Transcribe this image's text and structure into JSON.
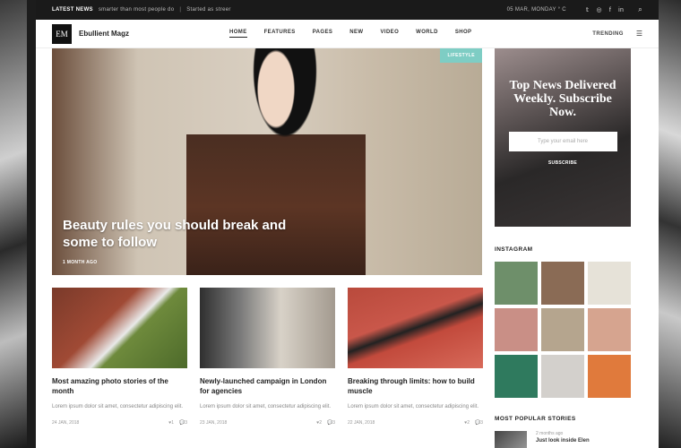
{
  "topbar": {
    "label": "LATEST NEWS",
    "ticker1": "smarter than most people do",
    "ticker2": "Started as streer",
    "date": "05 MAR, MONDAY ° C"
  },
  "header": {
    "logo": "EM",
    "site_name": "Ebullient Magz",
    "nav": [
      "HOME",
      "FEATURES",
      "PAGES",
      "NEW",
      "VIDEO",
      "WORLD",
      "SHOP"
    ],
    "trending": "TRENDING"
  },
  "hero": {
    "tag": "LIFESTYLE",
    "title": "Beauty rules you should break and some to follow",
    "time": "1 MONTH AGO"
  },
  "cards": [
    {
      "title": "Most amazing photo stories of the month",
      "excerpt": "Lorem ipsum dolor sit amet, consectetur adipiscing elit.",
      "date": "24 JAN, 2018",
      "likes": "1",
      "comments": "3"
    },
    {
      "title": "Newly-launched campaign in London for agencies",
      "excerpt": "Lorem ipsum dolor sit amet, consectetur adipiscing elit.",
      "date": "23 JAN, 2018",
      "likes": "2",
      "comments": "3"
    },
    {
      "title": "Breaking through limits: how to build muscle",
      "excerpt": "Lorem ipsum dolor sit amet, consectetur adipiscing elit.",
      "date": "22 JAN, 2018",
      "likes": "2",
      "comments": "3"
    }
  ],
  "sidebar": {
    "subscribe_title": "Top News Delivered Weekly. Subscribe Now.",
    "email_placeholder": "Type your email here",
    "subscribe_button": "SUBSCRIBE",
    "instagram_heading": "INSTAGRAM",
    "instagram_colors": [
      "#6e8f6a",
      "#8a6b55",
      "#e6e2d8",
      "#c98f86",
      "#b5a58e",
      "#d6a48f",
      "#2f7a5e",
      "#d3d0cc",
      "#e07a3c"
    ],
    "popular_heading": "MOST POPULAR STORIES",
    "popular_time": "2 months ago",
    "popular_title": "Just look inside Elen"
  },
  "icons": {
    "twitter": "𝕥",
    "instagram": "◎",
    "facebook": "f",
    "linkedin": "in",
    "search": "⌕",
    "menu": "☰",
    "heart": "♥",
    "comment": "💬"
  }
}
